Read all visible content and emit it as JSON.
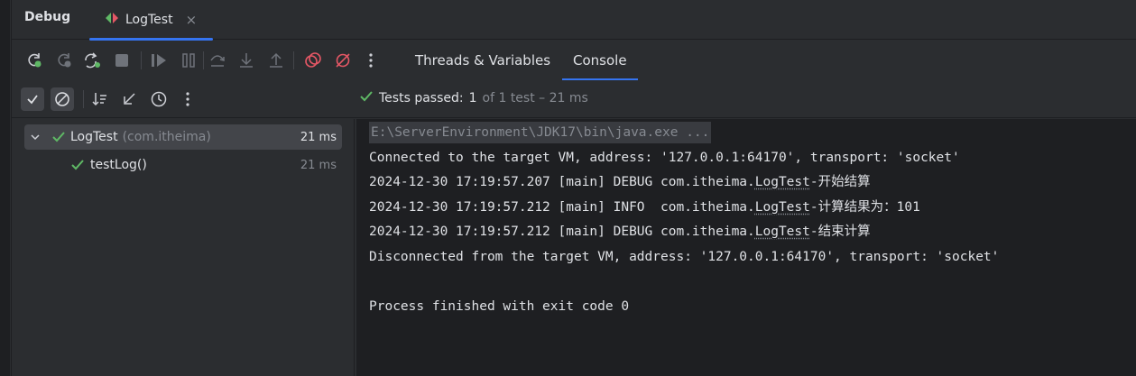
{
  "tool_window": {
    "title": "Debug",
    "run_tab": {
      "label": "LogTest",
      "close": "×"
    }
  },
  "toolbar": {
    "tabs": [
      {
        "label": "Threads & Variables",
        "active": false
      },
      {
        "label": "Console",
        "active": true
      }
    ],
    "icons": [
      "rerun-icon",
      "rerun-failed-icon",
      "rerun-automatically-icon",
      "stop-icon",
      "resume-icon",
      "pause-icon",
      "step-over-icon",
      "step-into-icon",
      "step-out-icon",
      "view-breakpoints-icon",
      "mute-breakpoints-icon",
      "more-icon"
    ]
  },
  "test_toolbar": {
    "icons": [
      "show-passed-icon",
      "show-ignored-icon",
      "sort-icon",
      "collapse-icon",
      "history-icon",
      "more-icon"
    ],
    "status": {
      "label": "Tests passed:",
      "count": "1",
      "detail": "of 1 test – 21 ms"
    }
  },
  "tree": [
    {
      "name": "LogTest",
      "package": "(com.itheima)",
      "time": "21 ms",
      "level": 0,
      "selected": true
    },
    {
      "name": "testLog()",
      "time": "21 ms",
      "level": 1,
      "selected": false
    }
  ],
  "console": {
    "command": "E:\\ServerEnvironment\\JDK17\\bin\\java.exe ...",
    "connected": "Connected to the target VM, address: '127.0.0.1:64170', transport: 'socket'",
    "logs": [
      {
        "prefix": "2024-12-30 17:19:57.207 [main] DEBUG com.itheima.",
        "cls": "LogTest",
        "suffix": "-开始结算"
      },
      {
        "prefix": "2024-12-30 17:19:57.212 [main] INFO  com.itheima.",
        "cls": "LogTest",
        "suffix": "-计算结果为：101"
      },
      {
        "prefix": "2024-12-30 17:19:57.212 [main] DEBUG com.itheima.",
        "cls": "LogTest",
        "suffix": "-结束计算"
      }
    ],
    "disconnected": "Disconnected from the target VM, address: '127.0.0.1:64170', transport: 'socket'",
    "blank": "",
    "finished": "Process finished with exit code 0"
  },
  "colors": {
    "accent": "#3574f0",
    "pass_green": "#5fb865",
    "breakpoint_red": "#e55765"
  }
}
